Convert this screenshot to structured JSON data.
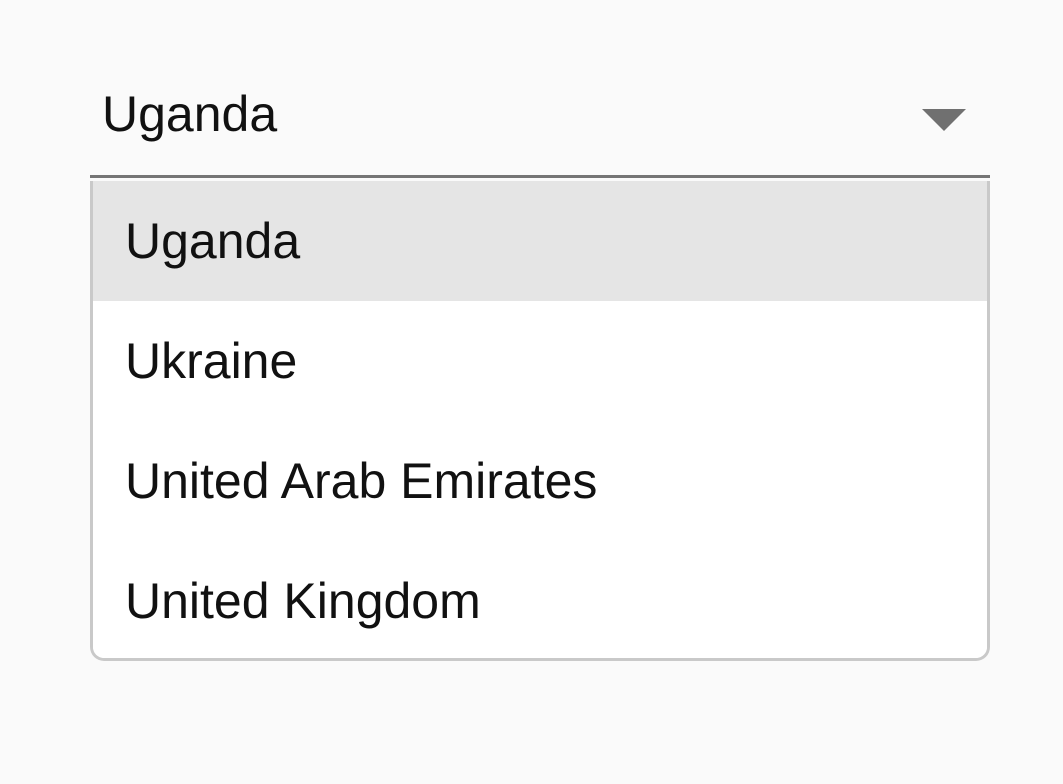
{
  "select": {
    "value": "Uganda",
    "arrow_icon": "triangle-down-icon"
  },
  "menu": {
    "items": [
      {
        "label": "Uganda",
        "selected": true
      },
      {
        "label": "Ukraine",
        "selected": false
      },
      {
        "label": "United Arab Emirates",
        "selected": false
      },
      {
        "label": "United Kingdom",
        "selected": false
      }
    ]
  },
  "colors": {
    "background": "#fafafa",
    "selected_item": "#e5e5e5",
    "underline": "#757575",
    "arrow": "#707070",
    "text": "#111111"
  }
}
